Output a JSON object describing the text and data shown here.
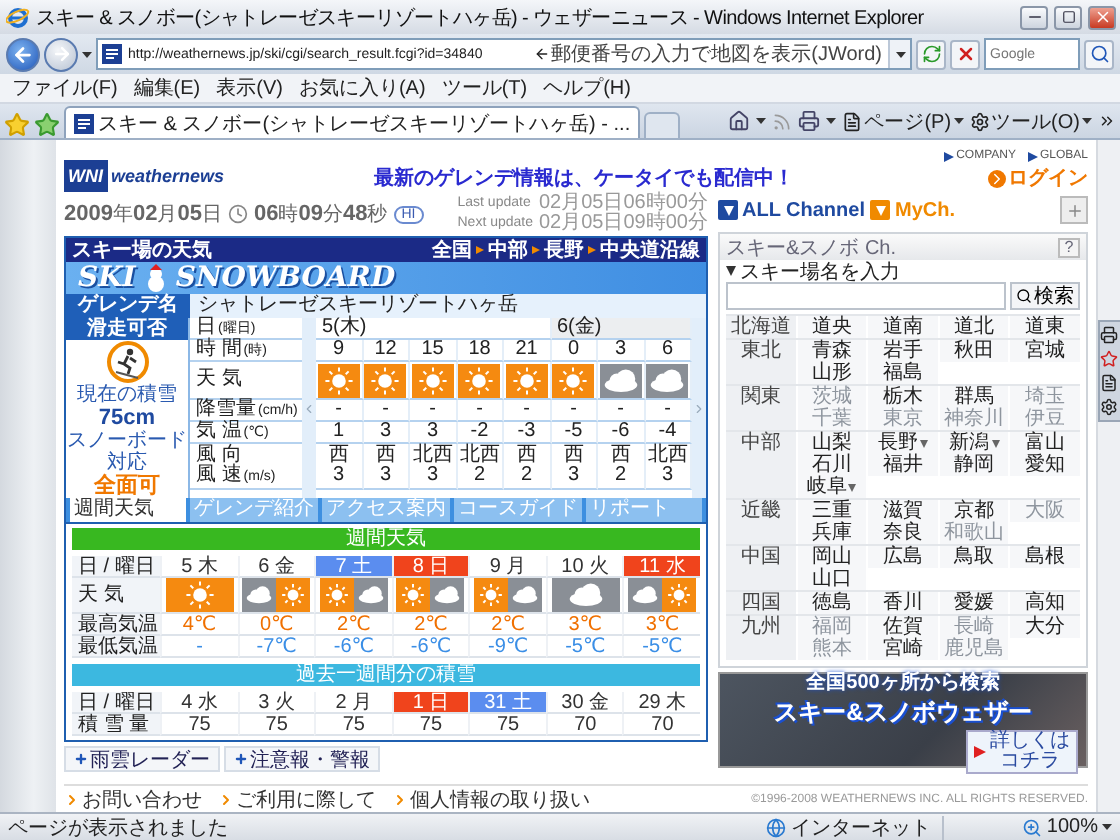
{
  "window": {
    "title": "スキー & スノボー(シャトレーゼスキーリゾートハヶ岳) - ウェザーニュース - Windows Internet Explorer"
  },
  "address_bar": {
    "url": "http://weathernews.jp/ski/cgi/search_result.fcgi?id=34840",
    "hint": "郵便番号の入力で地図を表示(JWord)",
    "search_placeholder": "Google"
  },
  "menu": [
    "ファイル(F)",
    "編集(E)",
    "表示(V)",
    "お気に入り(A)",
    "ツール(T)",
    "ヘルプ(H)"
  ],
  "tabs": [
    {
      "label": "スキー & スノボー(シャトレーゼスキーリゾートハヶ岳) - ...",
      "selected": true
    }
  ],
  "command_bar": [
    "ページ(P)",
    "ツール(O)"
  ],
  "site_header": {
    "logo_mark": "WNI",
    "logo_text": "weathernews",
    "notice": "最新のゲレンデ情報は、ケータイでも配信中！",
    "links": [
      "COMPANY",
      "GLOBAL"
    ],
    "login": "ログイン"
  },
  "datetime": {
    "date": [
      {
        "value": "2009",
        "unit": "年"
      },
      {
        "value": "02",
        "unit": "月"
      },
      {
        "value": "05",
        "unit": "日"
      }
    ],
    "time": [
      {
        "value": "06",
        "unit": "時"
      },
      {
        "value": "09",
        "unit": "分"
      },
      {
        "value": "48",
        "unit": "秒"
      }
    ],
    "badge": "HI",
    "updates": [
      {
        "label": "Last update",
        "value": "02月05日06時00分"
      },
      {
        "label": "Next update",
        "value": "02月05日09時00分"
      }
    ]
  },
  "ski_panel": {
    "title": "スキー場の天気",
    "breadcrumb": [
      "全国",
      "中部",
      "長野",
      "中央道沿線"
    ],
    "logo": [
      "SKI",
      "SNOWBOARD"
    ],
    "resort_label": "ゲレンデ名",
    "resort_name": "シャトレーゼスキーリゾートハヶ岳",
    "status": {
      "label": "滑走可否",
      "depth_label": "現在の積雪",
      "depth": "75cm",
      "snowboard_label": "スノーボード対応",
      "snowboard": "全面可"
    },
    "row_labels": [
      {
        "text": "日",
        "unit": "(曜日)"
      },
      {
        "text": "時 間",
        "unit": "(時)"
      },
      {
        "text": "天 気"
      },
      {
        "text": "降雪量",
        "unit": "(cm/h)"
      },
      {
        "text": "気 温",
        "unit": "(℃)"
      },
      {
        "text": "風 向"
      },
      {
        "text": "風 速",
        "unit": "(m/s)"
      }
    ],
    "days": [
      {
        "label": "5(木)",
        "hours": [
          {
            "time": "9",
            "kind": "sun",
            "snow": "-",
            "temp": "1",
            "wind_dir": "西",
            "wind_speed": "3"
          },
          {
            "time": "12",
            "kind": "sun",
            "snow": "-",
            "temp": "3",
            "wind_dir": "西",
            "wind_speed": "3"
          },
          {
            "time": "15",
            "kind": "sun",
            "snow": "-",
            "temp": "3",
            "wind_dir": "北西",
            "wind_speed": "3"
          },
          {
            "time": "18",
            "kind": "sun",
            "snow": "-",
            "temp": "-2",
            "wind_dir": "北西",
            "wind_speed": "2"
          },
          {
            "time": "21",
            "kind": "sun",
            "snow": "-",
            "temp": "-3",
            "wind_dir": "西",
            "wind_speed": "2"
          }
        ]
      },
      {
        "label": "6(金)",
        "hours": [
          {
            "time": "0",
            "kind": "sun",
            "snow": "-",
            "temp": "-5",
            "wind_dir": "西",
            "wind_speed": "3"
          },
          {
            "time": "3",
            "kind": "cloud",
            "snow": "-",
            "temp": "-6",
            "wind_dir": "西",
            "wind_speed": "2"
          },
          {
            "time": "6",
            "kind": "cloud",
            "snow": "-",
            "temp": "-4",
            "wind_dir": "北西",
            "wind_speed": "3"
          }
        ]
      }
    ],
    "tabs": [
      {
        "label": "週間天気",
        "selected": true
      },
      {
        "label": "ゲレンデ紹介",
        "selected": false
      },
      {
        "label": "アクセス案内",
        "selected": false
      },
      {
        "label": "コースガイド",
        "selected": false
      },
      {
        "label": "リポート",
        "selected": false
      }
    ]
  },
  "weekly": {
    "title": "週間天気",
    "row_labels": [
      "日 / 曜日",
      "天 気",
      "最高気温",
      "最低気温"
    ],
    "days": [
      {
        "label": "5 木",
        "color": "#ffffff",
        "kind": "sun",
        "high": "4℃",
        "low": "-"
      },
      {
        "label": "6 金",
        "color": "#ffffff",
        "kind": "cloud_sun",
        "high": "0℃",
        "low": "-7℃"
      },
      {
        "label": "7 土",
        "color": "#5b8def",
        "kind": "sun_cloud",
        "high": "2℃",
        "low": "-6℃"
      },
      {
        "label": "8 日",
        "color": "#f0441c",
        "kind": "sun_cloud",
        "high": "2℃",
        "low": "-6℃"
      },
      {
        "label": "9 月",
        "color": "#ffffff",
        "kind": "sun_cloud",
        "high": "2℃",
        "low": "-9℃"
      },
      {
        "label": "10 火",
        "color": "#ffffff",
        "kind": "cloud",
        "high": "3℃",
        "low": "-5℃"
      },
      {
        "label": "11 水",
        "color": "#f0441c",
        "kind": "cloud_sun",
        "high": "3℃",
        "low": "-5℃"
      }
    ]
  },
  "past_snow": {
    "title": "過去一週間分の積雪",
    "row_labels": [
      "日 / 曜日",
      "積 雪 量"
    ],
    "days": [
      {
        "label": "4 水",
        "color": "#ffffff",
        "snow": "75"
      },
      {
        "label": "3 火",
        "color": "#ffffff",
        "snow": "75"
      },
      {
        "label": "2 月",
        "color": "#ffffff",
        "snow": "75"
      },
      {
        "label": "1 日",
        "color": "#f0441c",
        "snow": "75"
      },
      {
        "label": "31 土",
        "color": "#5b8def",
        "snow": "75"
      },
      {
        "label": "30 金",
        "color": "#ffffff",
        "snow": "70"
      },
      {
        "label": "29 木",
        "color": "#ffffff",
        "snow": "70"
      }
    ]
  },
  "extra_links": [
    "雨雲レーダー",
    "注意報・警報"
  ],
  "footer": {
    "links": [
      "お問い合わせ",
      "ご利用に際して",
      "個人情報の取り扱い"
    ],
    "copyright": "©1996-2008 WEATHERNEWS INC. ALL RIGHTS RESERVED."
  },
  "sidebar": {
    "channels": [
      {
        "label": "ALL Channel",
        "kind": "all"
      },
      {
        "label": "MyCh.",
        "kind": "my"
      }
    ],
    "title": "スキー&スノボ Ch.",
    "help": "?",
    "search_label": "スキー場名を入力",
    "search_button": "検索",
    "regions": [
      {
        "name": "北海道",
        "areas": [
          {
            "name": "道央",
            "disabled": false,
            "expandable": false
          },
          {
            "name": "道南",
            "disabled": false,
            "expandable": false
          },
          {
            "name": "道北",
            "disabled": false,
            "expandable": false
          },
          {
            "name": "道東",
            "disabled": false,
            "expandable": false
          }
        ]
      },
      {
        "name": "東北",
        "areas": [
          {
            "name": "青森",
            "disabled": false,
            "expandable": false
          },
          {
            "name": "岩手",
            "disabled": false,
            "expandable": false
          },
          {
            "name": "秋田",
            "disabled": false,
            "expandable": false
          },
          {
            "name": "宮城",
            "disabled": false,
            "expandable": false
          },
          {
            "name": "山形",
            "disabled": false,
            "expandable": false
          },
          {
            "name": "福島",
            "disabled": false,
            "expandable": false
          }
        ]
      },
      {
        "name": "関東",
        "areas": [
          {
            "name": "茨城",
            "disabled": true,
            "expandable": false
          },
          {
            "name": "栃木",
            "disabled": false,
            "expandable": false
          },
          {
            "name": "群馬",
            "disabled": false,
            "expandable": false
          },
          {
            "name": "埼玉",
            "disabled": true,
            "expandable": false
          },
          {
            "name": "千葉",
            "disabled": true,
            "expandable": false
          },
          {
            "name": "東京",
            "disabled": true,
            "expandable": false
          },
          {
            "name": "神奈川",
            "disabled": true,
            "expandable": false
          },
          {
            "name": "伊豆",
            "disabled": true,
            "expandable": false
          }
        ]
      },
      {
        "name": "中部",
        "areas": [
          {
            "name": "山梨",
            "disabled": false,
            "expandable": false
          },
          {
            "name": "長野",
            "disabled": false,
            "expandable": true
          },
          {
            "name": "新潟",
            "disabled": false,
            "expandable": true
          },
          {
            "name": "富山",
            "disabled": false,
            "expandable": false
          },
          {
            "name": "石川",
            "disabled": false,
            "expandable": false
          },
          {
            "name": "福井",
            "disabled": false,
            "expandable": false
          },
          {
            "name": "静岡",
            "disabled": false,
            "expandable": false
          },
          {
            "name": "愛知",
            "disabled": false,
            "expandable": false
          },
          {
            "name": "岐阜",
            "disabled": false,
            "expandable": true
          }
        ]
      },
      {
        "name": "近畿",
        "areas": [
          {
            "name": "三重",
            "disabled": false,
            "expandable": false
          },
          {
            "name": "滋賀",
            "disabled": false,
            "expandable": false
          },
          {
            "name": "京都",
            "disabled": false,
            "expandable": false
          },
          {
            "name": "大阪",
            "disabled": true,
            "expandable": false
          },
          {
            "name": "兵庫",
            "disabled": false,
            "expandable": false
          },
          {
            "name": "奈良",
            "disabled": false,
            "expandable": false
          },
          {
            "name": "和歌山",
            "disabled": true,
            "expandable": false
          }
        ]
      },
      {
        "name": "中国",
        "areas": [
          {
            "name": "岡山",
            "disabled": false,
            "expandable": false
          },
          {
            "name": "広島",
            "disabled": false,
            "expandable": false
          },
          {
            "name": "鳥取",
            "disabled": false,
            "expandable": false
          },
          {
            "name": "島根",
            "disabled": false,
            "expandable": false
          },
          {
            "name": "山口",
            "disabled": false,
            "expandable": false
          }
        ]
      },
      {
        "name": "四国",
        "areas": [
          {
            "name": "徳島",
            "disabled": false,
            "expandable": false
          },
          {
            "name": "香川",
            "disabled": false,
            "expandable": false
          },
          {
            "name": "愛媛",
            "disabled": false,
            "expandable": false
          },
          {
            "name": "高知",
            "disabled": false,
            "expandable": false
          }
        ]
      },
      {
        "name": "九州",
        "areas": [
          {
            "name": "福岡",
            "disabled": true,
            "expandable": false
          },
          {
            "name": "佐賀",
            "disabled": false,
            "expandable": false
          },
          {
            "name": "長崎",
            "disabled": true,
            "expandable": false
          },
          {
            "name": "大分",
            "disabled": false,
            "expandable": false
          },
          {
            "name": "熊本",
            "disabled": true,
            "expandable": false
          },
          {
            "name": "宮崎",
            "disabled": false,
            "expandable": false
          },
          {
            "name": "鹿児島",
            "disabled": true,
            "expandable": false
          }
        ]
      }
    ],
    "ad": {
      "headline": "全国500ヶ所から検索",
      "title": "スキー&スノボウェザー",
      "button": [
        "詳しくは",
        "コチラ"
      ]
    }
  },
  "status_bar": {
    "text": "ページが表示されました",
    "zone": "インターネット",
    "zoom": "100%"
  }
}
